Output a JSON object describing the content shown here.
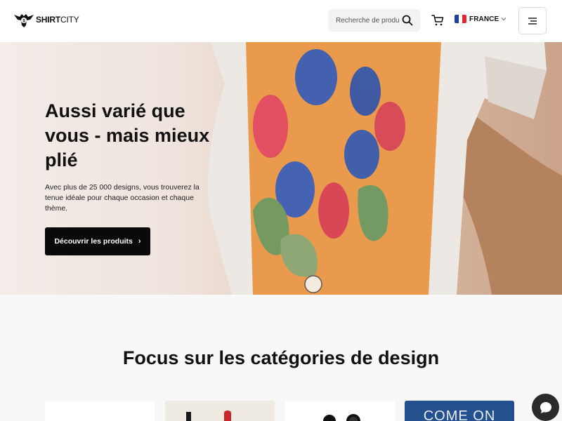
{
  "header": {
    "logo_text_bold": "SHIRT",
    "logo_text_light": "CITY",
    "search": {
      "placeholder": "Recherche de produi"
    },
    "country": {
      "label": "FRANCE",
      "flag_colors": [
        "#1f3fa5",
        "#ffffff",
        "#e0262e"
      ]
    }
  },
  "hero": {
    "title": "Aussi varié que vous - mais mieux plié",
    "text": "Avec plus de 25 000 designs, vous trouverez la tenue idéale pour chaque occasion et chaque thème.",
    "cta_label": "Découvrir les produits",
    "cta_arrow": "›"
  },
  "categories": {
    "title": "Focus sur les catégories de design",
    "cards": [
      {
        "name": "card-1"
      },
      {
        "name": "card-2"
      },
      {
        "name": "card-3"
      },
      {
        "name": "card-4",
        "text": "COME ON"
      }
    ]
  },
  "colors": {
    "accent": "#0a0a0a",
    "hero_tshirt_print": "#e99a4c",
    "category_blue": "#25508f"
  },
  "icons": {
    "logo": "eagle-logo-icon",
    "search": "search-icon",
    "cart": "cart-icon",
    "menu": "hamburger-icon",
    "chat": "chat-icon"
  }
}
